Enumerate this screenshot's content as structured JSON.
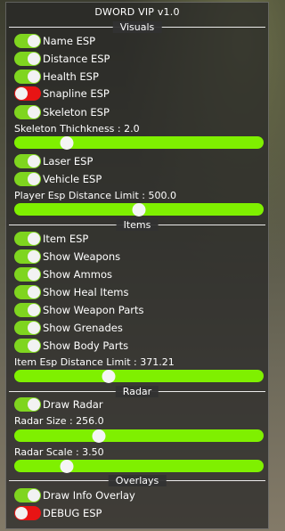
{
  "window": {
    "title": "DWORD VIP v1.0"
  },
  "sections": {
    "visuals": "Visuals",
    "items": "Items",
    "radar": "Radar",
    "overlays": "Overlays"
  },
  "toggles": {
    "name_esp": {
      "label": "Name ESP",
      "on": true
    },
    "distance_esp": {
      "label": "Distance ESP",
      "on": true
    },
    "health_esp": {
      "label": "Health ESP",
      "on": true
    },
    "snapline_esp": {
      "label": "Snapline ESP",
      "on": false
    },
    "skeleton_esp": {
      "label": "Skeleton ESP",
      "on": true
    },
    "laser_esp": {
      "label": "Laser ESP",
      "on": true
    },
    "vehicle_esp": {
      "label": "Vehicle ESP",
      "on": true
    },
    "item_esp": {
      "label": "Item ESP",
      "on": true
    },
    "show_weapons": {
      "label": "Show Weapons",
      "on": true
    },
    "show_ammos": {
      "label": "Show Ammos",
      "on": true
    },
    "show_heal_items": {
      "label": "Show Heal Items",
      "on": true
    },
    "show_weapon_parts": {
      "label": "Show Weapon Parts",
      "on": true
    },
    "show_grenades": {
      "label": "Show Grenades",
      "on": true
    },
    "show_body_parts": {
      "label": "Show Body Parts",
      "on": true
    },
    "draw_radar": {
      "label": "Draw Radar",
      "on": true
    },
    "draw_info_overlay": {
      "label": "Draw Info Overlay",
      "on": true
    },
    "debug_esp": {
      "label": "DEBUG ESP",
      "on": false
    }
  },
  "sliders": {
    "skeleton_thickness": {
      "label": "Skeleton Thichkness : 2.0",
      "fraction": 0.21
    },
    "player_esp_distance": {
      "label": "Player Esp Distance Limit : 500.0",
      "fraction": 0.5
    },
    "item_esp_distance": {
      "label": "Item Esp Distance Limit : 371.21",
      "fraction": 0.38
    },
    "radar_size": {
      "label": "Radar Size : 256.0",
      "fraction": 0.34
    },
    "radar_scale": {
      "label": "Radar Scale : 3.50",
      "fraction": 0.21
    }
  },
  "colors": {
    "toggle_on": "#7fd51f",
    "toggle_off": "#e81414",
    "slider_track": "#7ff000",
    "knob": "#f2f2f2"
  }
}
